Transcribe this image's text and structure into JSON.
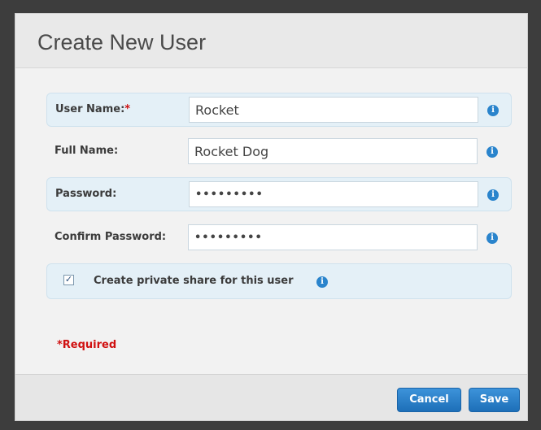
{
  "dialog": {
    "title": "Create New User"
  },
  "form": {
    "username": {
      "label": "User Name:",
      "required_marker": "*",
      "value": "Rocket"
    },
    "fullname": {
      "label": "Full Name:",
      "value": "Rocket Dog"
    },
    "password": {
      "label": "Password:",
      "value": "•••••••••"
    },
    "confirm_password": {
      "label": "Confirm Password:",
      "value": "•••••••••"
    },
    "private_share": {
      "label": "Create private share for this user",
      "checked": true
    },
    "required_note": "*Required"
  },
  "footer": {
    "cancel_label": "Cancel",
    "save_label": "Save"
  },
  "icons": {
    "info": "info-icon",
    "checkmark": "checkmark-icon"
  },
  "colors": {
    "accent": "#2a84cc",
    "required": "#d01010",
    "highlight_row": "#e4f0f7"
  }
}
